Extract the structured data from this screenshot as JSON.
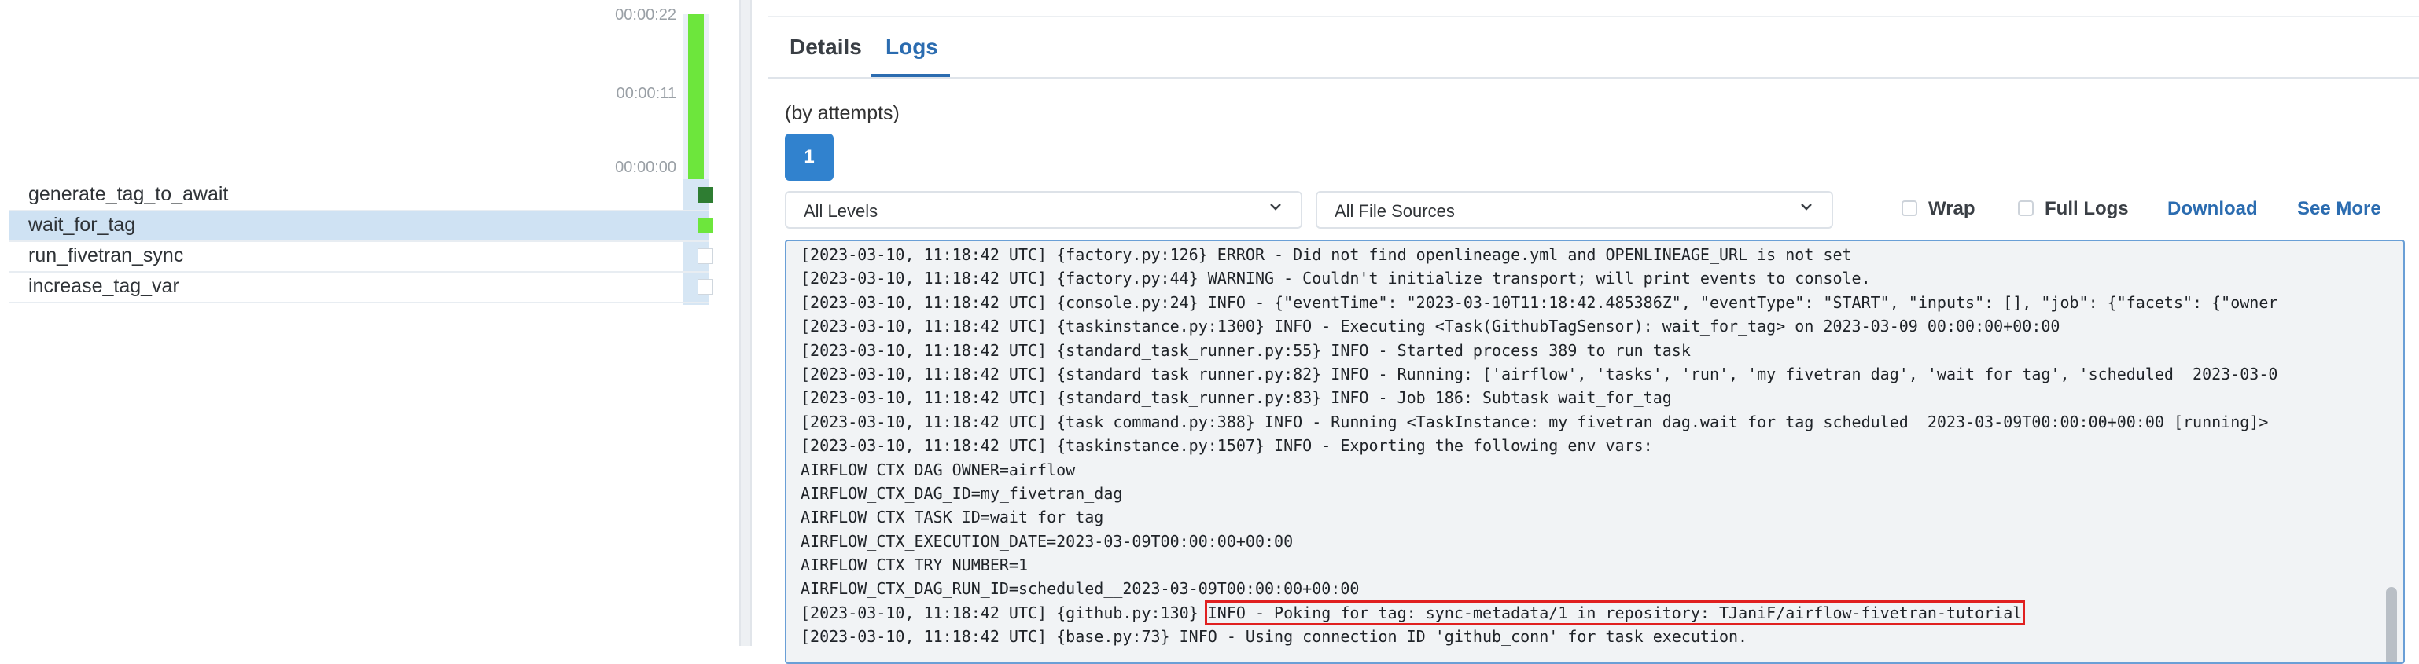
{
  "grid": {
    "durations": [
      "00:00:22",
      "00:00:11",
      "00:00:00"
    ],
    "run_status_color": "#6de63c",
    "run_fill_fraction": 1.0,
    "tasks": [
      {
        "name": "generate_tag_to_await",
        "state": "success",
        "color": "#2e7d32",
        "selected": false
      },
      {
        "name": "wait_for_tag",
        "state": "running",
        "color": "#6de63c",
        "selected": true
      },
      {
        "name": "run_fivetran_sync",
        "state": "none",
        "color": "#ffffff",
        "selected": false
      },
      {
        "name": "increase_tag_var",
        "state": "none",
        "color": "#ffffff",
        "selected": false
      }
    ]
  },
  "details": {
    "tabs": [
      {
        "label": "Details",
        "active": false
      },
      {
        "label": "Logs",
        "active": true
      }
    ],
    "attempts_label": "(by attempts)",
    "attempt_number": "1",
    "level_select": "All Levels",
    "source_select": "All File Sources",
    "wrap_label": "Wrap",
    "full_logs_label": "Full Logs",
    "download_label": "Download",
    "see_more_label": "See More",
    "accent_color": "#2b6cb0",
    "highlight_color": "#e02020",
    "log_lines": [
      {
        "prefix": "[2023-03-10, 11:18:42 UTC] {factory.py:126} ERROR - Did not find openlineage.yml and OPENLINEAGE_URL is not set",
        "highlight": ""
      },
      {
        "prefix": "[2023-03-10, 11:18:42 UTC] {factory.py:44} WARNING - Couldn't initialize transport; will print events to console.",
        "highlight": ""
      },
      {
        "prefix": "[2023-03-10, 11:18:42 UTC] {console.py:24} INFO - {\"eventTime\": \"2023-03-10T11:18:42.485386Z\", \"eventType\": \"START\", \"inputs\": [], \"job\": {\"facets\": {\"owner",
        "highlight": ""
      },
      {
        "prefix": "[2023-03-10, 11:18:42 UTC] {taskinstance.py:1300} INFO - Executing <Task(GithubTagSensor): wait_for_tag> on 2023-03-09 00:00:00+00:00",
        "highlight": ""
      },
      {
        "prefix": "[2023-03-10, 11:18:42 UTC] {standard_task_runner.py:55} INFO - Started process 389 to run task",
        "highlight": ""
      },
      {
        "prefix": "[2023-03-10, 11:18:42 UTC] {standard_task_runner.py:82} INFO - Running: ['airflow', 'tasks', 'run', 'my_fivetran_dag', 'wait_for_tag', 'scheduled__2023-03-0",
        "highlight": ""
      },
      {
        "prefix": "[2023-03-10, 11:18:42 UTC] {standard_task_runner.py:83} INFO - Job 186: Subtask wait_for_tag",
        "highlight": ""
      },
      {
        "prefix": "[2023-03-10, 11:18:42 UTC] {task_command.py:388} INFO - Running <TaskInstance: my_fivetran_dag.wait_for_tag scheduled__2023-03-09T00:00:00+00:00 [running]>",
        "highlight": ""
      },
      {
        "prefix": "[2023-03-10, 11:18:42 UTC] {taskinstance.py:1507} INFO - Exporting the following env vars:",
        "highlight": ""
      },
      {
        "prefix": "AIRFLOW_CTX_DAG_OWNER=airflow",
        "highlight": ""
      },
      {
        "prefix": "AIRFLOW_CTX_DAG_ID=my_fivetran_dag",
        "highlight": ""
      },
      {
        "prefix": "AIRFLOW_CTX_TASK_ID=wait_for_tag",
        "highlight": ""
      },
      {
        "prefix": "AIRFLOW_CTX_EXECUTION_DATE=2023-03-09T00:00:00+00:00",
        "highlight": ""
      },
      {
        "prefix": "AIRFLOW_CTX_TRY_NUMBER=1",
        "highlight": ""
      },
      {
        "prefix": "AIRFLOW_CTX_DAG_RUN_ID=scheduled__2023-03-09T00:00:00+00:00",
        "highlight": ""
      },
      {
        "prefix": "[2023-03-10, 11:18:42 UTC] {github.py:130} ",
        "highlight": "INFO - Poking for tag: sync-metadata/1 in repository: TJaniF/airflow-fivetran-tutorial"
      },
      {
        "prefix": "[2023-03-10, 11:18:42 UTC] {base.py:73} INFO - Using connection ID 'github_conn' for task execution.",
        "highlight": ""
      }
    ]
  }
}
